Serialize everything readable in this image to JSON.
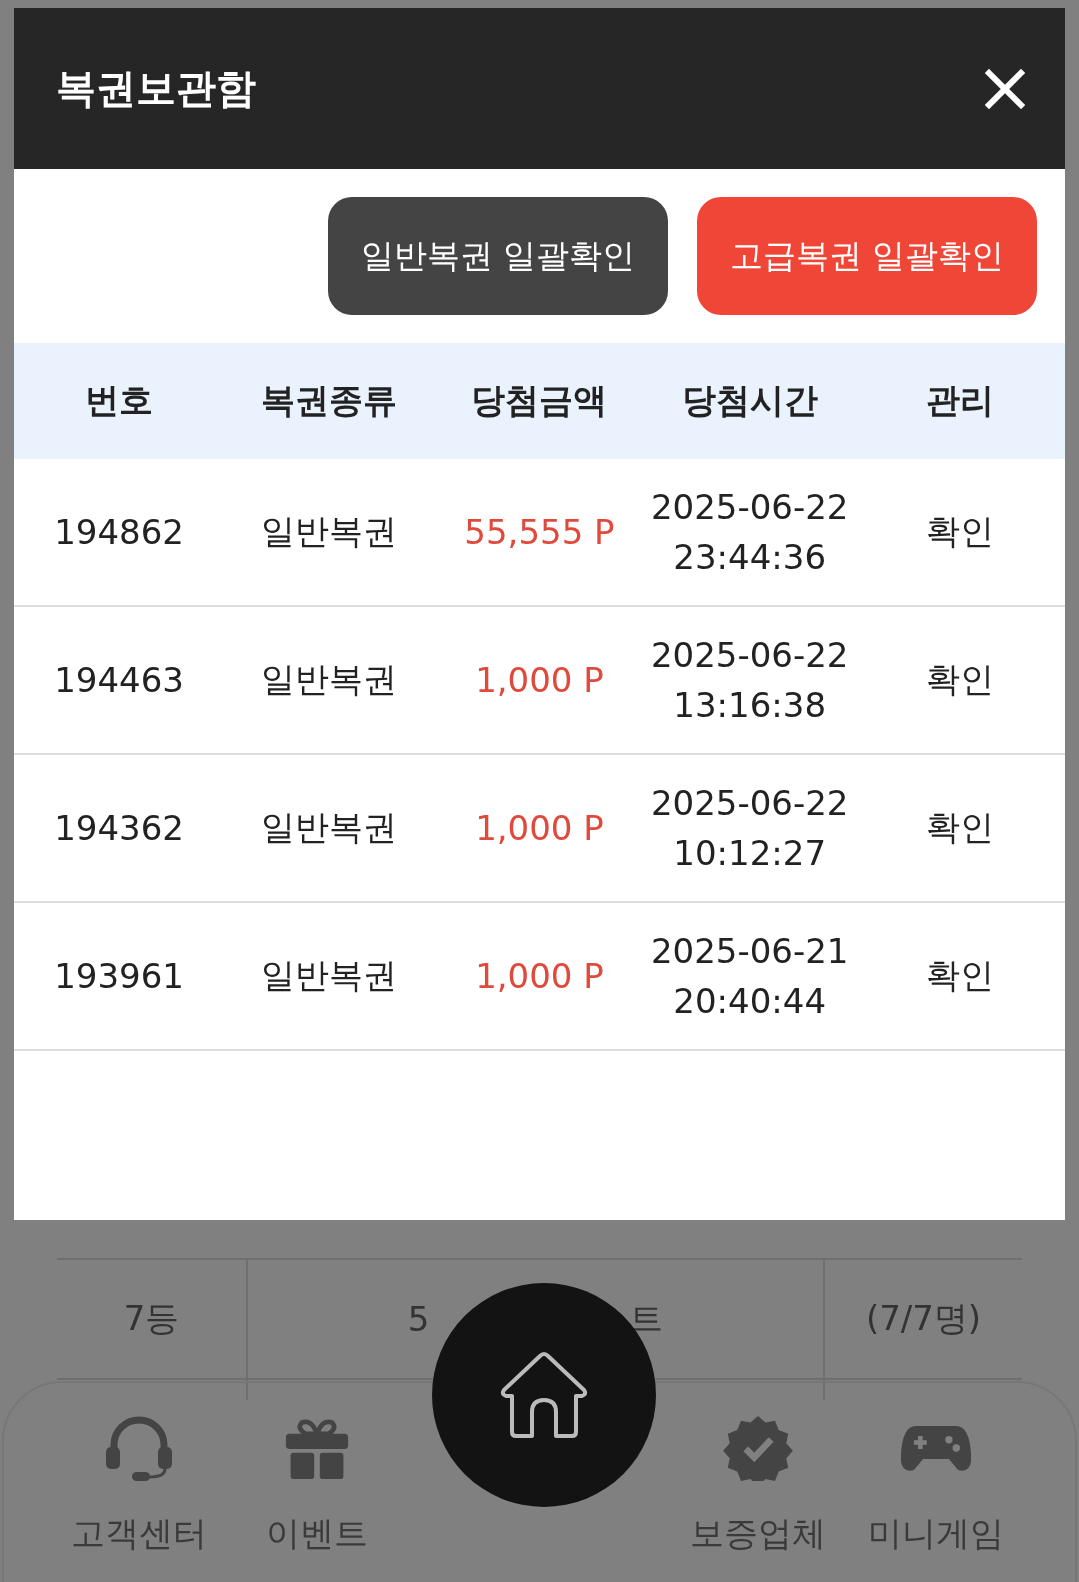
{
  "dialog": {
    "title": "복권보관함",
    "buttons": [
      {
        "label": "일반복권 일괄확인",
        "kind": "normal"
      },
      {
        "label": "고급복권 일괄확인",
        "kind": "premium"
      }
    ],
    "table": {
      "columns": [
        "번호",
        "복권종류",
        "당첨금액",
        "당첨시간",
        "관리"
      ],
      "rows": [
        {
          "number": "194862",
          "type": "일반복권",
          "amount": "55,555 P",
          "date": "2025-06-22",
          "time": "23:44:36",
          "action": "확인"
        },
        {
          "number": "194463",
          "type": "일반복권",
          "amount": "1,000 P",
          "date": "2025-06-22",
          "time": "13:16:38",
          "action": "확인"
        },
        {
          "number": "194362",
          "type": "일반복권",
          "amount": "1,000 P",
          "date": "2025-06-22",
          "time": "10:12:27",
          "action": "확인"
        },
        {
          "number": "193961",
          "type": "일반복권",
          "amount": "1,000 P",
          "date": "2025-06-21",
          "time": "20:40:44",
          "action": "확인"
        }
      ]
    }
  },
  "background_table": {
    "rank": "7등",
    "prize_start": "5",
    "prize_end": "트",
    "count": "(7/7명)"
  },
  "bottom_nav": {
    "items": [
      {
        "label": "고객센터",
        "kind": "support"
      },
      {
        "label": "이벤트",
        "kind": "event"
      },
      {
        "label": "보증업체",
        "kind": "verified"
      },
      {
        "label": "미니게임",
        "kind": "game"
      }
    ]
  }
}
